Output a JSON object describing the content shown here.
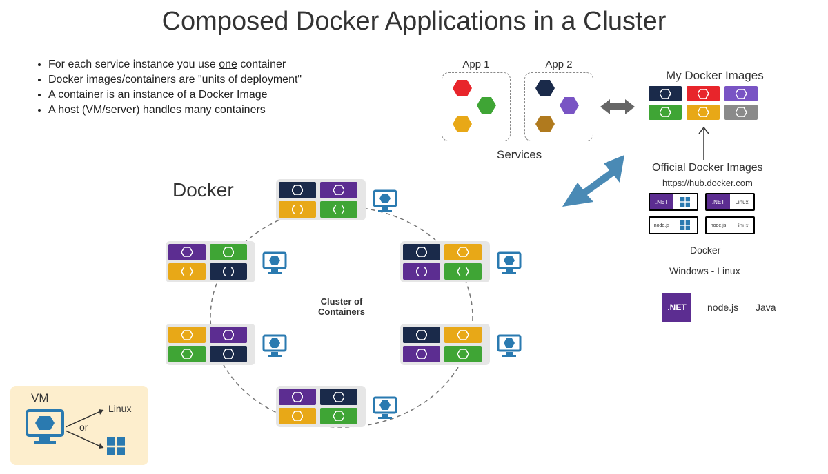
{
  "title": "Composed Docker Applications in a Cluster",
  "bullets": {
    "b1a": "For each service instance you use ",
    "b1u": "one",
    "b1b": " container",
    "b2": "Docker images/containers are \"units of deployment\"",
    "b3a": "A container is an ",
    "b3u": "instance",
    "b3b": " of a Docker Image",
    "b4": "A host (VM/server) handles many containers"
  },
  "apps": {
    "app1": "App 1",
    "app2": "App 2",
    "services": "Services"
  },
  "mdi": {
    "title": "My Docker Images"
  },
  "odi": {
    "title": "Official Docker Images",
    "link": "https://hub.docker.com",
    "net": ".NET",
    "nodejs": "node.js",
    "linux": "Linux",
    "docker": "Docker",
    "winlinux": "Windows  -  Linux",
    "java": "Java"
  },
  "cluster": {
    "docker": "Docker",
    "label": "Cluster of Containers"
  },
  "vm": {
    "label": "VM",
    "linux": "Linux",
    "or": "or"
  },
  "colors": {
    "navy": "#1a2a4a",
    "red": "#e8252b",
    "purple": "#5c2d91",
    "green": "#3fa535",
    "yellow": "#e8a817",
    "brown": "#b07a1e",
    "lightpurple": "#7954c4",
    "grey": "#8a8a8a",
    "blue": "#2a7ab0"
  }
}
